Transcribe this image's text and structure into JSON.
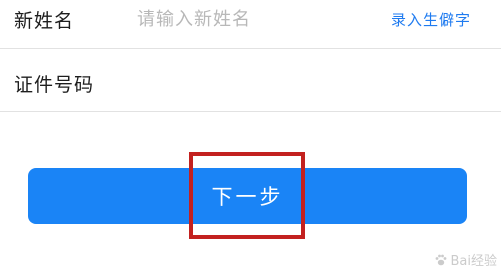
{
  "form": {
    "new_name": {
      "label": "新姓名",
      "value": "",
      "placeholder": "请输入新姓名",
      "rare_char_link": "录入生僻字"
    },
    "id_number": {
      "label": "证件号码"
    }
  },
  "next_button": {
    "label": "下一步"
  },
  "watermark": {
    "text": "Bai经验"
  },
  "colors": {
    "accent": "#1a84f6",
    "link": "#1f7bf0",
    "highlight": "#c3211f"
  }
}
